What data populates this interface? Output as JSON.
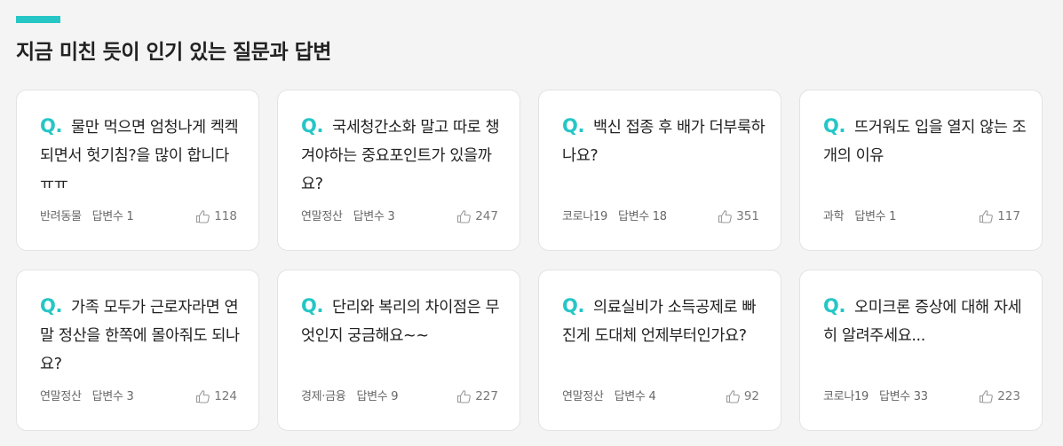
{
  "section": {
    "title": "지금 미친 듯이 인기 있는 질문과 답변",
    "accent_color": "#26c6c6"
  },
  "q_mark": "Q.",
  "cards": [
    {
      "question": "물만 먹으면 엄청나게 켁켁되면서 헛기침?을 많이 합니다 ㅠㅠ",
      "category": "반려동물",
      "answers": "답변수 1",
      "likes": "118"
    },
    {
      "question": "국세청간소화 말고 따로 챙겨야하는 중요포인트가 있을까요?",
      "category": "연말정산",
      "answers": "답변수 3",
      "likes": "247"
    },
    {
      "question": "백신 접종 후 배가 더부룩하나요?",
      "category": "코로나19",
      "answers": "답변수 18",
      "likes": "351"
    },
    {
      "question": "뜨거워도 입을 열지 않는 조개의 이유",
      "category": "과학",
      "answers": "답변수 1",
      "likes": "117"
    },
    {
      "question": "가족 모두가 근로자라면 연말 정산을 한쪽에 몰아줘도 되나요?",
      "category": "연말정산",
      "answers": "답변수 3",
      "likes": "124"
    },
    {
      "question": "단리와 복리의 차이점은 무엇인지 궁금해요~~",
      "category": "경제·금융",
      "answers": "답변수 9",
      "likes": "227"
    },
    {
      "question": "의료실비가 소득공제로 빠진게 도대체 언제부터인가요?",
      "category": "연말정산",
      "answers": "답변수 4",
      "likes": "92"
    },
    {
      "question": "오미크론 증상에 대해 자세히 알려주세요...",
      "category": "코로나19",
      "answers": "답변수 33",
      "likes": "223"
    }
  ],
  "icons": {
    "likes": "thumbs-up-icon"
  }
}
